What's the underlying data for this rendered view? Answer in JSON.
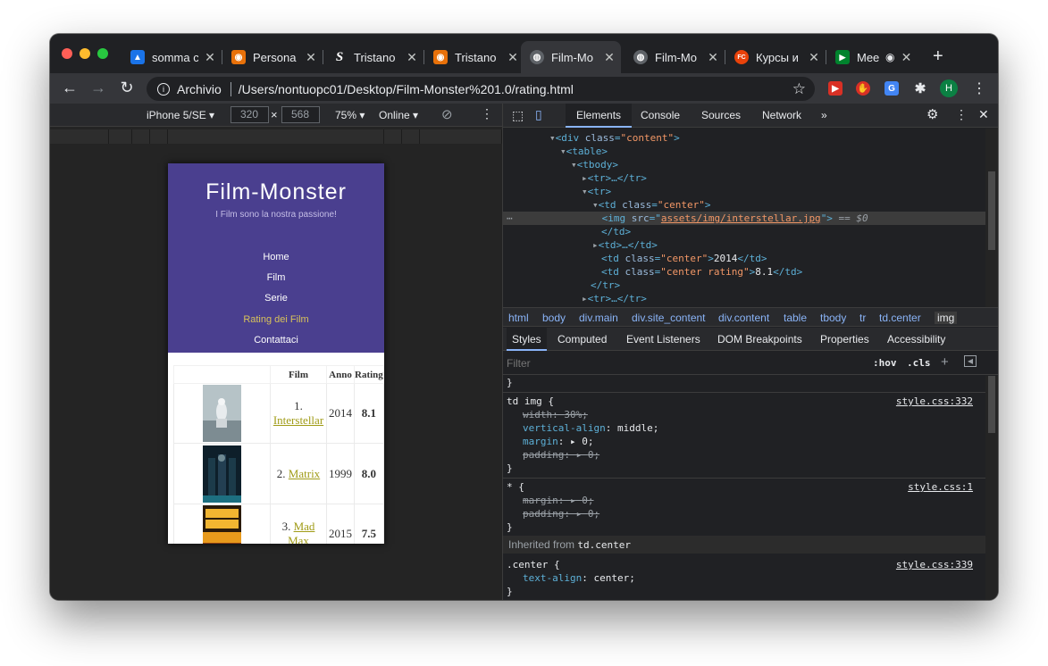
{
  "colors": {
    "close": "#ff5f57",
    "minimize": "#febc2e",
    "maximize": "#28c840"
  },
  "tabs": [
    {
      "title": "somma c",
      "favicon": "person-icon",
      "favicon_color": "#1a73e8",
      "favicon_glyph": "▲"
    },
    {
      "title": "Persona",
      "favicon": "github-icon",
      "favicon_color": "#e8710a",
      "favicon_glyph": "◉"
    },
    {
      "title": "Tristano",
      "favicon": "s-icon",
      "favicon_color": "#202124",
      "favicon_glyph": "S"
    },
    {
      "title": "Tristano",
      "favicon": "github-icon",
      "favicon_color": "#e8710a",
      "favicon_glyph": "◉"
    },
    {
      "title": "Film-Mo",
      "favicon": "globe-icon",
      "favicon_color": "#5f6368",
      "favicon_glyph": "◍"
    },
    {
      "title": "Film-Mo",
      "favicon": "globe-icon",
      "favicon_color": "#5f6368",
      "favicon_glyph": "◍"
    },
    {
      "title": "Курсы и",
      "favicon": "fc-icon",
      "favicon_color": "#e8420a",
      "favicon_glyph": "FC"
    },
    {
      "title": "Mee",
      "favicon": "meet-icon",
      "favicon_color": "#00832d",
      "favicon_glyph": "▶"
    }
  ],
  "toolbar": {
    "scheme": "Archivio",
    "url": "/Users/nontuopc01/Desktop/Film-Monster%201.0/rating.html"
  },
  "profile": {
    "initial": "H"
  },
  "device": {
    "name": "iPhone 5/SE ▾",
    "width": "320",
    "times": "×",
    "height": "568",
    "zoom": "75% ▾",
    "network": "Online ▾"
  },
  "site": {
    "title": "Film-Monster",
    "subtitle": "I Film sono la nostra passione!",
    "nav": [
      "Home",
      "Film",
      "Serie",
      "Rating dei Film",
      "Contattaci"
    ],
    "table": {
      "headers": [
        "",
        "Film",
        "Anno",
        "Rating"
      ],
      "rows": [
        {
          "rank": "1.",
          "title": "Interstellar",
          "year": "2014",
          "rating": "8.1"
        },
        {
          "rank": "2.",
          "title": "Matrix",
          "year": "1999",
          "rating": "8.0"
        },
        {
          "rank": "3.",
          "title": "Mad Max",
          "year": "2015",
          "rating": "7.5"
        }
      ]
    }
  },
  "devtools": {
    "tabs": [
      "Elements",
      "Console",
      "Sources",
      "Network",
      "»"
    ],
    "dom": {
      "l1_tag": "<div ",
      "l1_attr": "class",
      "l1_val": "\"content\"",
      "l1_end": ">",
      "l2": "<table>",
      "l3": "<tbody>",
      "l4": "<tr>…</tr>",
      "l5": "<tr>",
      "l6_tag": "<td ",
      "l6_attr": "class",
      "l6_val": "\"center\"",
      "l6_end": ">",
      "l7_tag": "<img ",
      "l7_attr": "src",
      "l7_val": "assets/img/interstellar.jpg",
      "l7_end": "\">",
      "l7_eq": " == $0",
      "l8": "</td>",
      "l9": "<td>…</td>",
      "l10_tag": "<td ",
      "l10_attr": "class",
      "l10_val": "\"center\"",
      "l10_text": "2014",
      "l10_close": "</td>",
      "l11_tag": "<td ",
      "l11_attr": "class",
      "l11_val": "\"center rating\"",
      "l11_text": "8.1",
      "l11_close": "</td>",
      "l12": "</tr>",
      "l13": "<tr>…</tr>"
    },
    "breadcrumbs": [
      "html",
      "body",
      "div.main",
      "div.site_content",
      "div.content",
      "table",
      "tbody",
      "tr",
      "td.center",
      "img"
    ],
    "style_tabs": [
      "Styles",
      "Computed",
      "Event Listeners",
      "DOM Breakpoints",
      "Properties",
      "Accessibility"
    ],
    "filter_placeholder": "Filter",
    "hov": ":hov",
    "cls": ".cls",
    "rules": {
      "r1_selector": "td img {",
      "r1_source": "style.css:332",
      "r1_p1": "width",
      "r1_v1": "30%;",
      "r1_p2": "vertical-align",
      "r1_v2": "middle;",
      "r1_p3": "margin",
      "r1_v3": "0;",
      "r1_p4": "padding",
      "r1_v4": "0;",
      "r2_selector": "* {",
      "r2_source": "style.css:1",
      "r2_p1": "margin",
      "r2_v1": "0;",
      "r2_p2": "padding",
      "r2_v2": "0;",
      "inherited_label": "Inherited from",
      "inherited_from": "td.center",
      "r3_selector": ".center {",
      "r3_source": "style.css:339",
      "r3_p1": "text-align",
      "r3_v1": "center;",
      "close_brace": "}"
    }
  }
}
